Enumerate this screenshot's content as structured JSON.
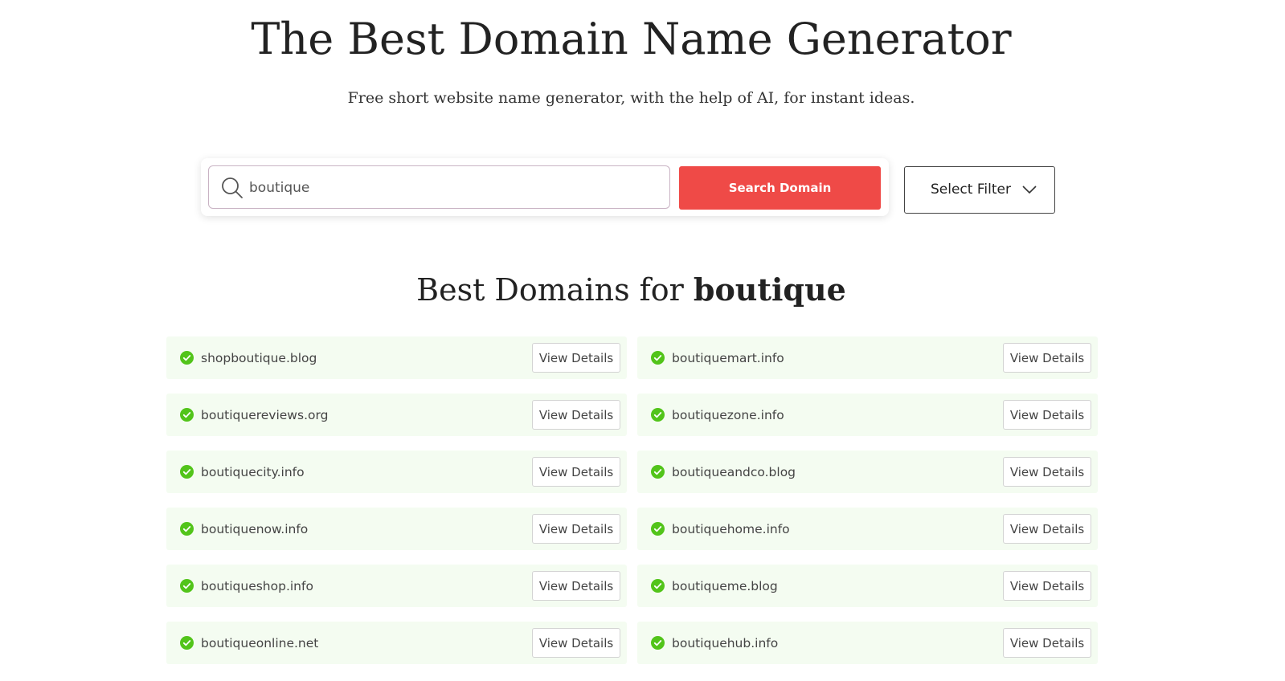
{
  "header": {
    "title": "The Best Domain Name Generator",
    "subtitle": "Free short website name generator, with the help of AI, for instant ideas."
  },
  "search": {
    "value": "boutique",
    "placeholder": "",
    "button_label": "Search Domain",
    "icon": "search-icon"
  },
  "filter": {
    "label": "Select Filter",
    "icon": "chevron-down-icon"
  },
  "results": {
    "heading_prefix": "Best Domains for",
    "keyword": "boutique",
    "status_icon": "check-circle-icon",
    "action_label": "View Details",
    "items": [
      {
        "domain": "shopboutique.blog",
        "action": "View Details"
      },
      {
        "domain": "boutiquemart.info",
        "action": "View Details"
      },
      {
        "domain": "boutiquereviews.org",
        "action": "View Details"
      },
      {
        "domain": "boutiquezone.info",
        "action": "View Details"
      },
      {
        "domain": "boutiquecity.info",
        "action": "View Details"
      },
      {
        "domain": "boutiqueandco.blog",
        "action": "View Details"
      },
      {
        "domain": "boutiquenow.info",
        "action": "View Details"
      },
      {
        "domain": "boutiquehome.info",
        "action": "View Details"
      },
      {
        "domain": "boutiqueshop.info",
        "action": "View Details"
      },
      {
        "domain": "boutiqueme.blog",
        "action": "View Details"
      },
      {
        "domain": "boutiqueonline.net",
        "action": "View Details"
      },
      {
        "domain": "boutiquehub.info",
        "action": "View Details"
      }
    ]
  },
  "colors": {
    "accent": "#ef4a47",
    "available": "#52c41a",
    "row_background": "#f4fcf1"
  }
}
